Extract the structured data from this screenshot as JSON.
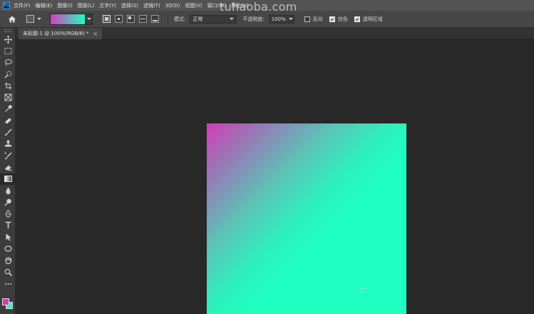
{
  "app": {
    "logo_text": "Ps"
  },
  "menu": [
    "文件(F)",
    "编辑(E)",
    "图像(I)",
    "图层(L)",
    "文字(Y)",
    "选择(S)",
    "滤镜(T)",
    "3D(D)",
    "视图(V)",
    "窗口(W)",
    "帮助(H)"
  ],
  "watermark": "tuhaoba.com",
  "options": {
    "gradient_colors": {
      "start": "#d63bbd",
      "end": "#1fffc2"
    },
    "mode_label": "模式:",
    "mode_value": "正常",
    "opacity_label": "不透明度:",
    "opacity_value": "100%",
    "reverse_label": "反向",
    "reverse_checked": false,
    "dither_label": "仿色",
    "dither_checked": true,
    "transparency_label": "透明区域",
    "transparency_checked": true
  },
  "document": {
    "tab_title": "未标题-1 @ 100%(RGB/8) *",
    "close_glyph": "×"
  },
  "tools": [
    "move-tool-icon",
    "marquee-tool-icon",
    "lasso-tool-icon",
    "quick-select-tool-icon",
    "crop-tool-icon",
    "frame-tool-icon",
    "eyedropper-tool-icon",
    "healing-brush-tool-icon",
    "brush-tool-icon",
    "clone-stamp-tool-icon",
    "history-brush-tool-icon",
    "eraser-tool-icon",
    "gradient-tool-icon",
    "blur-tool-icon",
    "dodge-tool-icon",
    "pen-tool-icon",
    "type-tool-icon",
    "path-select-tool-icon",
    "ellipse-tool-icon",
    "hand-tool-icon",
    "zoom-tool-icon",
    "more-tools-icon"
  ],
  "colors": {
    "foreground": "#d63bbd",
    "background": "#1fffc2"
  }
}
